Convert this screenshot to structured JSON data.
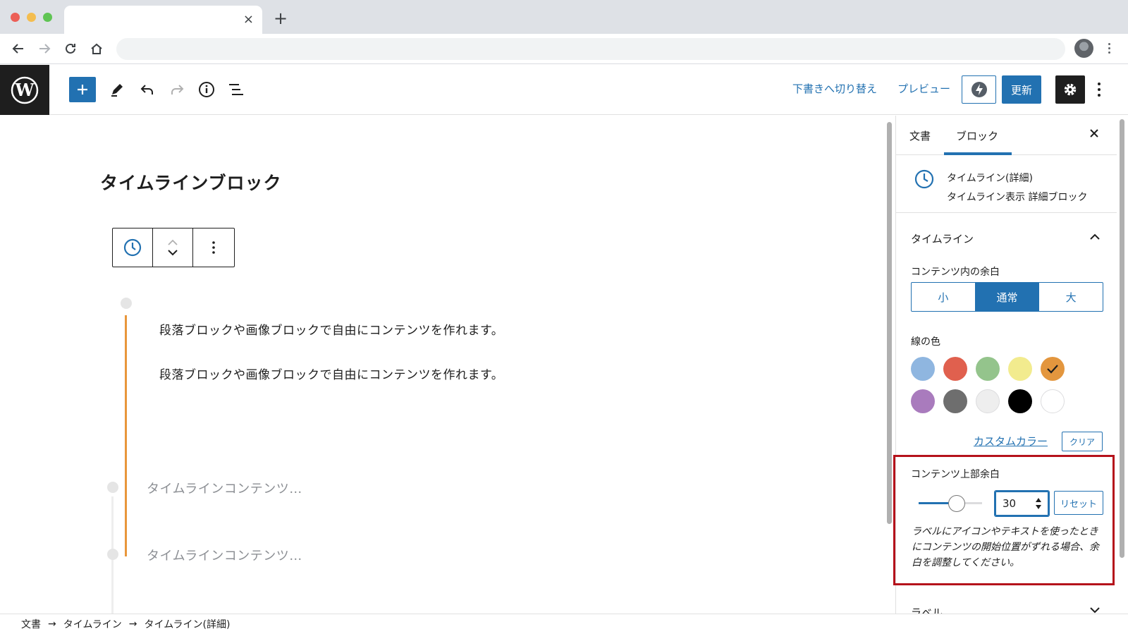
{
  "browser": {
    "tab_close": "×",
    "new_tab": "+",
    "back_icon": "arrow-left-icon",
    "forward_icon": "arrow-right-icon",
    "reload_icon": "reload-icon",
    "home_icon": "home-icon"
  },
  "header": {
    "add_icon": "plus-icon",
    "tools_icon": "pencil-icon",
    "undo_icon": "undo-icon",
    "redo_icon": "redo-icon",
    "info_icon": "info-icon",
    "list_view_icon": "list-view-icon",
    "switch_to_draft": "下書きへ切り替え",
    "preview": "プレビュー",
    "update": "更新",
    "accent_color": "#2271b1"
  },
  "editor": {
    "title": "タイムラインブロック",
    "paragraphs": [
      "段落ブロックや画像ブロックで自由にコンテンツを作れます。",
      "段落ブロックや画像ブロックで自由にコンテンツを作れます。"
    ],
    "placeholders": [
      "タイムラインコンテンツ…",
      "タイムラインコンテンツ…"
    ],
    "line_color": "#e8963b"
  },
  "sidebar": {
    "tabs": [
      "文書",
      "ブロック"
    ],
    "active_tab": "ブロック",
    "block_card": {
      "title": "タイムライン(詳細)",
      "description": "タイムライン表示 詳細ブロック"
    },
    "panel_title": "タイムライン",
    "padding_label": "コンテンツ内の余白",
    "padding_options": [
      "小",
      "通常",
      "大"
    ],
    "padding_selected": "通常",
    "line_color_label": "線の色",
    "swatches": [
      "#8fb6e0",
      "#e0604e",
      "#94c48c",
      "#f2eb8e",
      "#e3963e",
      "#a97bbd",
      "#6e6e6e",
      "#eeeeee",
      "#000000",
      "#ffffff"
    ],
    "selected_swatch": "#e3963e",
    "custom_color": "カスタムカラー",
    "clear": "クリア",
    "top_padding_label": "コンテンツ上部余白",
    "top_padding_value": "30",
    "top_padding_slider_fraction": 0.6,
    "reset": "リセット",
    "help": "ラベルにアイコンやテキストを使ったときにコンテンツの開始位置がずれる場合、余白を調整してください。",
    "label_panel": "ラベル",
    "highlight_color": "#b5121b"
  },
  "breadcrumb": [
    "文書",
    "タイムライン",
    "タイムライン(詳細)"
  ],
  "breadcrumb_sep": "→"
}
